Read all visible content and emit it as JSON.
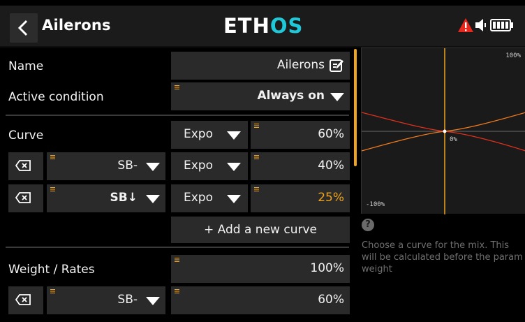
{
  "header": {
    "title": "Ailerons",
    "logo_part1": "ETH",
    "logo_part2": "OS",
    "icons": [
      "back-icon",
      "warning-icon",
      "speaker-icon",
      "battery-icon"
    ]
  },
  "rows": {
    "name": {
      "label": "Name",
      "value": "Ailerons"
    },
    "active_condition": {
      "label": "Active condition",
      "value": "Always on"
    },
    "curve": {
      "label": "Curve",
      "type": "Expo",
      "value": "60%"
    },
    "curve_alt1": {
      "switch": "SB-",
      "type": "Expo",
      "value": "40%"
    },
    "curve_alt2": {
      "switch": "SB↓",
      "type": "Expo",
      "value": "25%"
    },
    "add_curve_label": "+ Add a new curve",
    "weight": {
      "label": "Weight / Rates",
      "value": "100%"
    },
    "weight_alt1": {
      "switch": "SB-",
      "value": "60%"
    }
  },
  "graph": {
    "top_label": "100%",
    "center_label": "0%",
    "bottom_label": "-100%"
  },
  "help": {
    "icon": "?",
    "text": "Choose a curve for the mix. This will be calculated before the param weight"
  },
  "colors": {
    "accent": "#f0a41c",
    "logo_os": "#1ec8d8",
    "curve_red": "#e0301c",
    "curve_orange": "#f07a1c",
    "active_value": "#f0a41c"
  }
}
